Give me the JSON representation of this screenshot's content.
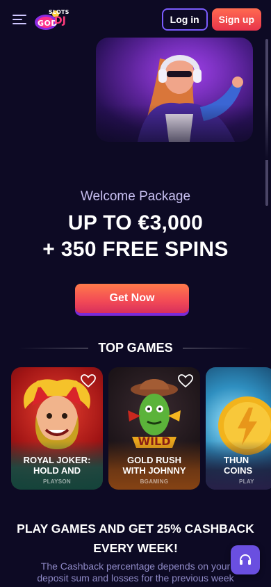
{
  "header": {
    "logo_top": "SLOTS",
    "logo_main": "GOD",
    "logo_dj": "DJ",
    "login_label": "Log in",
    "signup_label": "Sign up"
  },
  "hero": {
    "welcome": "Welcome Package",
    "headline_line1": "UP TO €3,000",
    "headline_line2": "+ 350 FREE SPINS",
    "cta_label": "Get Now"
  },
  "top_games": {
    "title": "TOP GAMES",
    "games": [
      {
        "title_line1": "ROYAL JOKER:",
        "title_line2": "HOLD AND",
        "provider": "PLAYSON"
      },
      {
        "title_line1": "GOLD RUSH",
        "title_line2": "WITH JOHNNY",
        "provider": "BGAMING"
      },
      {
        "title_line1": "THUN",
        "title_line2": "COINS",
        "provider": "PLAY"
      }
    ]
  },
  "cashback": {
    "title_line1": "PLAY GAMES AND GET 25% CASHBACK",
    "title_line2": "EVERY WEEK!",
    "desc_line1": "The Cashback percentage depends on your",
    "desc_line2": "deposit sum and losses for the previous week"
  },
  "colors": {
    "background": "#0d0a24",
    "accent_purple": "#7b5cff",
    "signup_red": "#e8344b",
    "cta_orange": "#ff7a4a"
  },
  "icons": {
    "menu": "hamburger-icon",
    "favorite": "heart-icon",
    "support": "headset-icon"
  }
}
